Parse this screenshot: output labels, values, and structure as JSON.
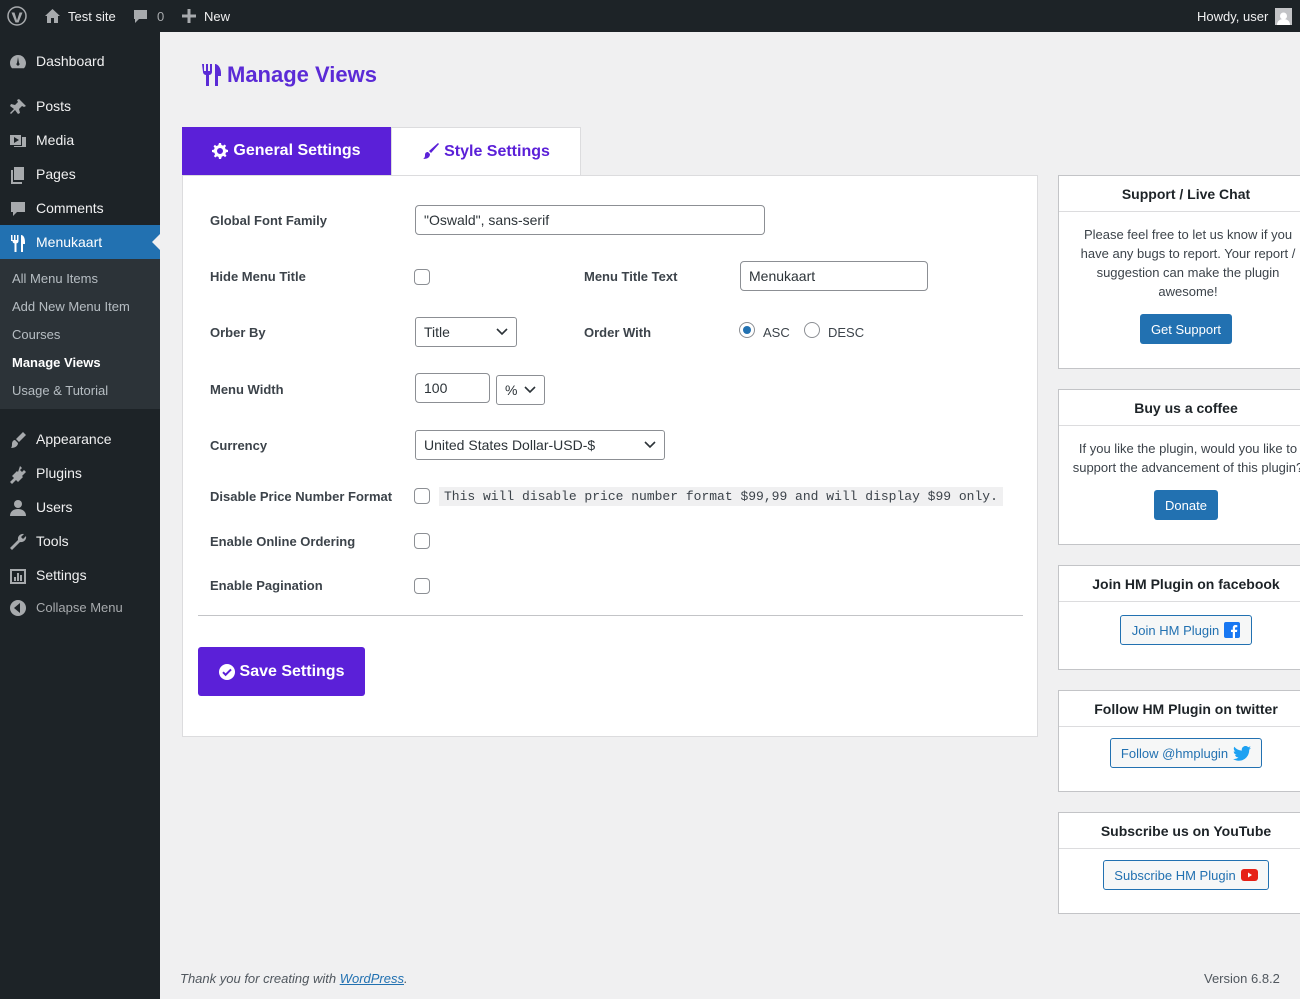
{
  "adminbar": {
    "site_name": "Test site",
    "comments_count": "0",
    "new_label": "New",
    "howdy": "Howdy, user"
  },
  "sidebar": {
    "items_top": [
      {
        "label": "Dashboard",
        "icon": "dashboard-icon"
      },
      {
        "label": "Posts",
        "icon": "pin-icon"
      },
      {
        "label": "Media",
        "icon": "media-icon"
      },
      {
        "label": "Pages",
        "icon": "pages-icon"
      },
      {
        "label": "Comments",
        "icon": "comment-icon"
      },
      {
        "label": "Menukaart",
        "icon": "utensils-icon",
        "active": true
      }
    ],
    "submenu": [
      {
        "label": "All Menu Items"
      },
      {
        "label": "Add New Menu Item"
      },
      {
        "label": "Courses"
      },
      {
        "label": "Manage Views",
        "current": true
      },
      {
        "label": "Usage & Tutorial"
      }
    ],
    "items_bottom": [
      {
        "label": "Appearance",
        "icon": "brush-icon"
      },
      {
        "label": "Plugins",
        "icon": "plug-icon"
      },
      {
        "label": "Users",
        "icon": "user-icon"
      },
      {
        "label": "Tools",
        "icon": "wrench-icon"
      },
      {
        "label": "Settings",
        "icon": "settings-icon"
      }
    ],
    "collapse_label": "Collapse Menu"
  },
  "page": {
    "title": "Manage Views",
    "tabs": [
      {
        "label": "General Settings",
        "active": true
      },
      {
        "label": "Style Settings",
        "active": false
      }
    ]
  },
  "form": {
    "global_font_family": {
      "label": "Global Font Family",
      "value": "\"Oswald\", sans-serif"
    },
    "hide_menu_title": {
      "label": "Hide Menu Title",
      "checked": false
    },
    "menu_title_text": {
      "label": "Menu Title Text",
      "value": "Menukaart"
    },
    "order_by": {
      "label": "Orber By",
      "value": "Title"
    },
    "order_with": {
      "label": "Order With",
      "options": [
        "ASC",
        "DESC"
      ],
      "selected": "ASC"
    },
    "menu_width": {
      "label": "Menu Width",
      "value": "100",
      "unit": "%"
    },
    "currency": {
      "label": "Currency",
      "value": "United States Dollar-USD-$"
    },
    "disable_price_format": {
      "label": "Disable Price Number Format",
      "checked": false,
      "note": "This will disable price number format $99,99 and will display $99 only."
    },
    "enable_online_ordering": {
      "label": "Enable Online Ordering",
      "checked": false
    },
    "enable_pagination": {
      "label": "Enable Pagination",
      "checked": false
    },
    "save_label": "Save Settings"
  },
  "widgets": {
    "support": {
      "title": "Support / Live Chat",
      "text": "Please feel free to let us know if you have any bugs to report. Your report / suggestion can make the plugin awesome!",
      "button": "Get Support"
    },
    "coffee": {
      "title": "Buy us a coffee",
      "text": "If you like the plugin, would you like to support the advancement of this plugin?",
      "button": "Donate"
    },
    "facebook": {
      "title": "Join HM Plugin on facebook",
      "button": "Join HM Plugin"
    },
    "twitter": {
      "title": "Follow HM Plugin on twitter",
      "button": "Follow @hmplugin"
    },
    "youtube": {
      "title": "Subscribe us on YouTube",
      "button": "Subscribe HM Plugin"
    }
  },
  "footer": {
    "thanks_prefix": "Thank you for creating with ",
    "thanks_link": "WordPress",
    "thanks_suffix": ".",
    "version": "Version 6.8.2"
  },
  "colors": {
    "accent": "#5b20d8",
    "wp_blue": "#2271b1",
    "admin_dark": "#1d2327"
  }
}
